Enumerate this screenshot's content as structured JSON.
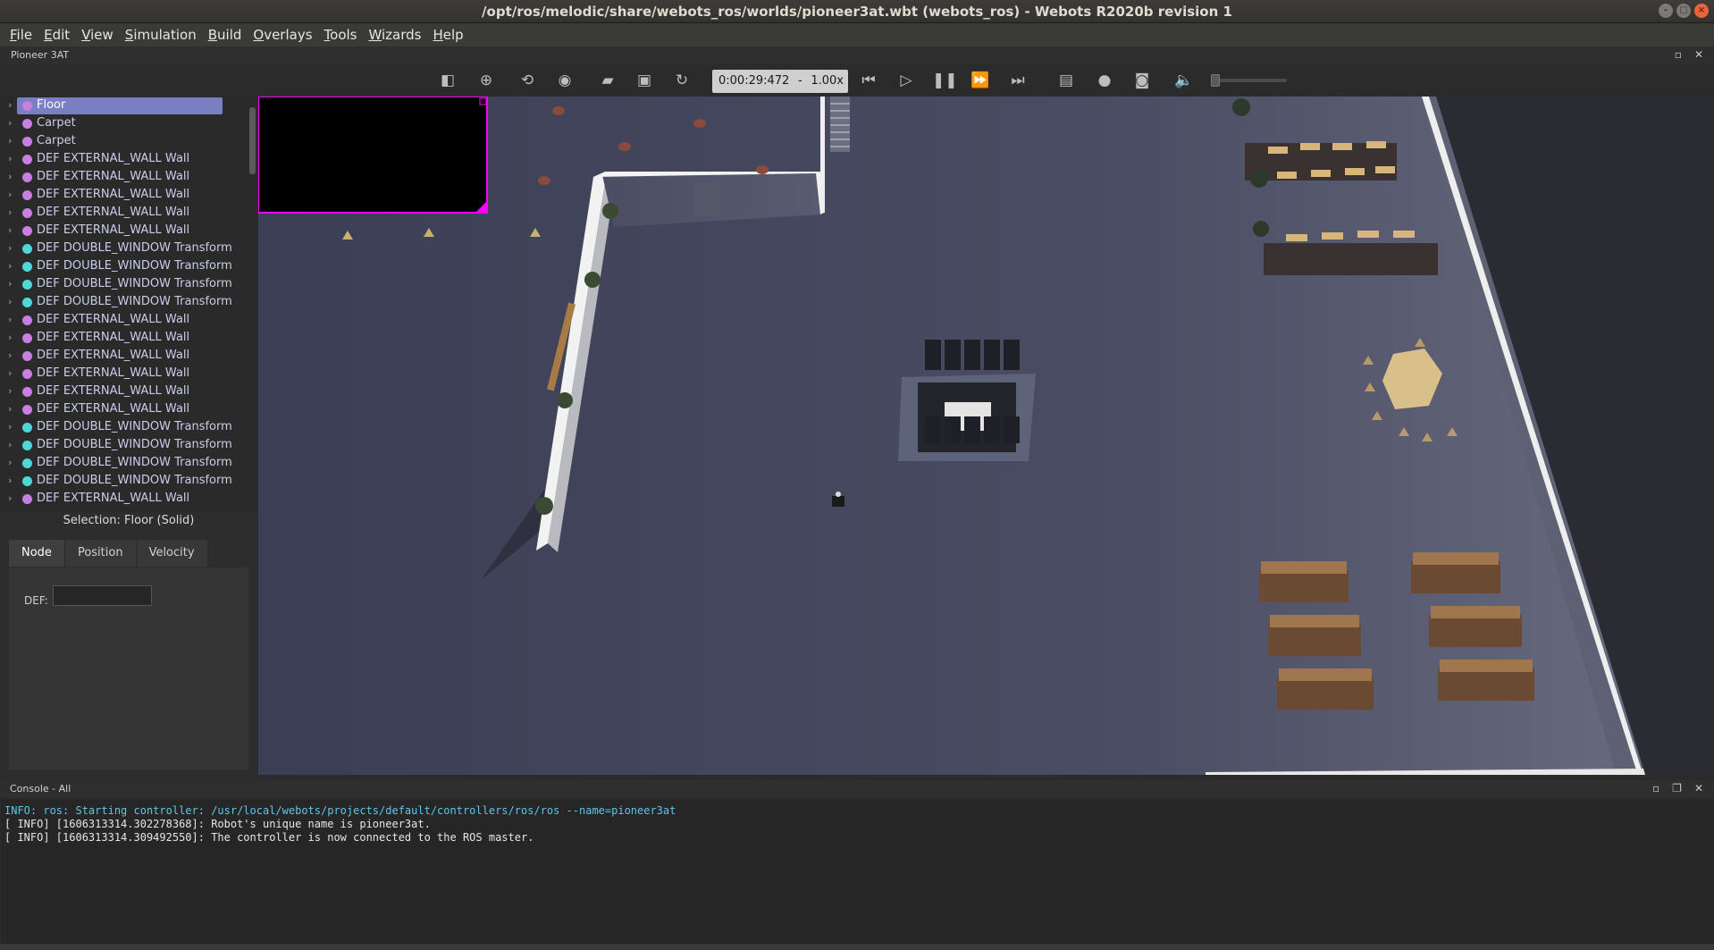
{
  "window": {
    "title": "/opt/ros/melodic/share/webots_ros/worlds/pioneer3at.wbt (webots_ros) - Webots R2020b revision 1",
    "buttons": [
      "minimize",
      "maximize",
      "close"
    ]
  },
  "menubar": {
    "items": [
      {
        "underline": "F",
        "rest": "ile"
      },
      {
        "underline": "E",
        "rest": "dit"
      },
      {
        "underline": "V",
        "rest": "iew"
      },
      {
        "underline": "S",
        "rest": "imulation"
      },
      {
        "underline": "B",
        "rest": "uild"
      },
      {
        "underline": "O",
        "rest": "verlays"
      },
      {
        "underline": "T",
        "rest": "ools"
      },
      {
        "underline": "W",
        "rest": "izards"
      },
      {
        "underline": "H",
        "rest": "elp"
      }
    ]
  },
  "robot_dock": {
    "title": "Pioneer 3AT"
  },
  "toolbar": {
    "icons": [
      "toggle-scene-tree-icon",
      "add-node-icon",
      "reset-view-icon",
      "view-icon",
      "open-world-icon",
      "save-world-icon",
      "reload-world-icon",
      "step-back-icon",
      "step-icon",
      "pause-icon",
      "fast-forward-icon",
      "fastest-icon",
      "record-movie-icon",
      "record-animation-icon",
      "screenshot-icon",
      "mute-icon"
    ],
    "time": "0:00:29:472",
    "dash": "-",
    "speed": "1.00x",
    "volume_fraction": 0.0
  },
  "scene_tree": {
    "items": [
      {
        "label": "Floor",
        "kind": "solid",
        "selected": true
      },
      {
        "label": "Carpet",
        "kind": "solid"
      },
      {
        "label": "Carpet",
        "kind": "solid"
      },
      {
        "label": "DEF EXTERNAL_WALL Wall",
        "kind": "solid"
      },
      {
        "label": "DEF EXTERNAL_WALL Wall",
        "kind": "solid"
      },
      {
        "label": "DEF EXTERNAL_WALL Wall",
        "kind": "solid"
      },
      {
        "label": "DEF EXTERNAL_WALL Wall",
        "kind": "solid"
      },
      {
        "label": "DEF EXTERNAL_WALL Wall",
        "kind": "solid"
      },
      {
        "label": "DEF DOUBLE_WINDOW Transform",
        "kind": "transform"
      },
      {
        "label": "DEF DOUBLE_WINDOW Transform",
        "kind": "transform"
      },
      {
        "label": "DEF DOUBLE_WINDOW Transform",
        "kind": "transform"
      },
      {
        "label": "DEF DOUBLE_WINDOW Transform",
        "kind": "transform"
      },
      {
        "label": "DEF EXTERNAL_WALL Wall",
        "kind": "solid"
      },
      {
        "label": "DEF EXTERNAL_WALL Wall",
        "kind": "solid"
      },
      {
        "label": "DEF EXTERNAL_WALL Wall",
        "kind": "solid"
      },
      {
        "label": "DEF EXTERNAL_WALL Wall",
        "kind": "solid"
      },
      {
        "label": "DEF EXTERNAL_WALL Wall",
        "kind": "solid"
      },
      {
        "label": "DEF EXTERNAL_WALL Wall",
        "kind": "solid"
      },
      {
        "label": "DEF DOUBLE_WINDOW Transform",
        "kind": "transform"
      },
      {
        "label": "DEF DOUBLE_WINDOW Transform",
        "kind": "transform"
      },
      {
        "label": "DEF DOUBLE_WINDOW Transform",
        "kind": "transform"
      },
      {
        "label": "DEF DOUBLE_WINDOW Transform",
        "kind": "transform"
      },
      {
        "label": "DEF EXTERNAL_WALL Wall",
        "kind": "solid"
      }
    ],
    "colors": {
      "solid": "#c77fe0",
      "transform": "#4fd6d6"
    }
  },
  "selection": {
    "title": "Selection: Floor (Solid)",
    "tabs": [
      "Node",
      "Position",
      "Velocity"
    ],
    "active_tab": "Node",
    "def_label": "DEF:",
    "def_value": ""
  },
  "console": {
    "title": "Console - All",
    "lines": [
      {
        "text": "INFO: ros: Starting controller: /usr/local/webots/projects/default/controllers/ros/ros --name=pioneer3at",
        "type": "info"
      },
      {
        "text": "[ INFO] [1606313314.302278368]: Robot's unique name is pioneer3at.",
        "type": "plain"
      },
      {
        "text": "[ INFO] [1606313314.309492550]: The controller is now connected to the ROS master.",
        "type": "plain"
      }
    ]
  },
  "colors": {
    "accent_selected": "#7a7fc4",
    "camera_overlay_border": "#ff00ff",
    "info_text": "#5fc6e6"
  }
}
